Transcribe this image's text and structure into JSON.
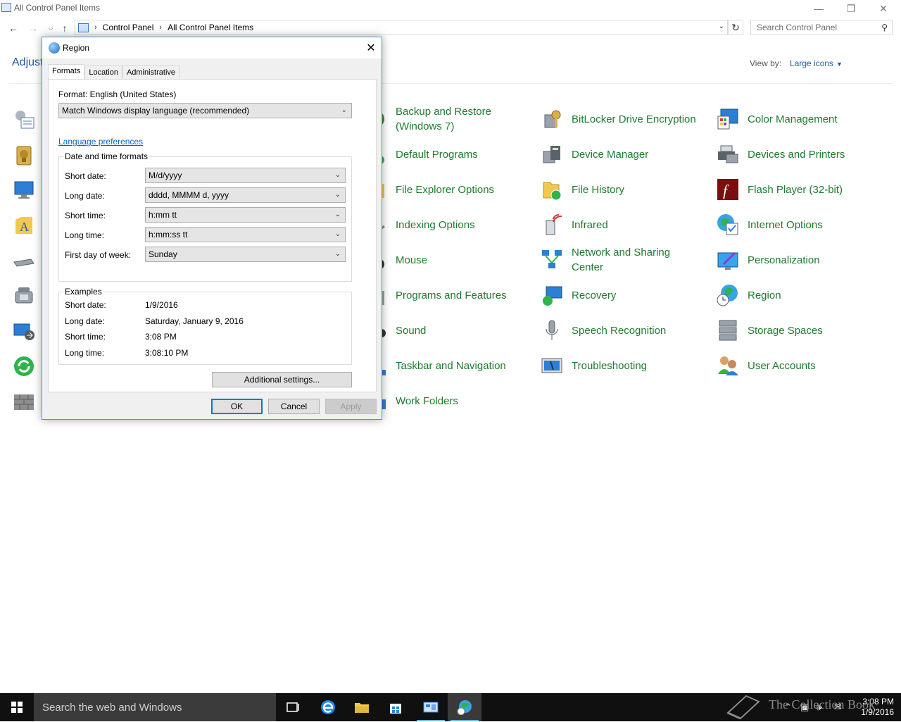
{
  "window": {
    "title": "All Control Panel Items"
  },
  "address": {
    "crumbs": [
      "Control Panel",
      "All Control Panel Items"
    ],
    "search_placeholder": "Search Control Panel"
  },
  "main": {
    "heading": "Adjust",
    "view_by_label": "View by:",
    "view_by_value": "Large icons"
  },
  "items": {
    "col1": [
      "Backup and Restore (Windows 7)",
      "Default Programs",
      "File Explorer Options",
      "Indexing Options",
      "Mouse",
      "Programs and Features",
      "Sound",
      "Taskbar and Navigation",
      "Work Folders"
    ],
    "col2": [
      "BitLocker Drive Encryption",
      "Device Manager",
      "File History",
      "Infrared",
      "Network and Sharing Center",
      "Recovery",
      "Speech Recognition",
      "Troubleshooting"
    ],
    "col3": [
      "Color Management",
      "Devices and Printers",
      "Flash Player (32-bit)",
      "Internet Options",
      "Personalization",
      "Region",
      "Storage Spaces",
      "User Accounts"
    ]
  },
  "dialog": {
    "title": "Region",
    "tabs": [
      "Formats",
      "Location",
      "Administrative"
    ],
    "format_label": "Format: English (United States)",
    "format_value": "Match Windows display language (recommended)",
    "language_link": "Language preferences",
    "dt_group_title": "Date and time formats",
    "fields": {
      "short_date": {
        "label": "Short date:",
        "value": "M/d/yyyy"
      },
      "long_date": {
        "label": "Long date:",
        "value": "dddd, MMMM d, yyyy"
      },
      "short_time": {
        "label": "Short time:",
        "value": "h:mm tt"
      },
      "long_time": {
        "label": "Long time:",
        "value": "h:mm:ss tt"
      },
      "first_day": {
        "label": "First day of week:",
        "value": "Sunday"
      }
    },
    "examples_title": "Examples",
    "examples": {
      "short_date": {
        "label": "Short date:",
        "value": "1/9/2016"
      },
      "long_date": {
        "label": "Long date:",
        "value": "Saturday, January 9, 2016"
      },
      "short_time": {
        "label": "Short time:",
        "value": "3:08 PM"
      },
      "long_time": {
        "label": "Long time:",
        "value": "3:08:10 PM"
      }
    },
    "additional_settings": "Additional settings...",
    "ok": "OK",
    "cancel": "Cancel",
    "apply": "Apply"
  },
  "taskbar": {
    "search_placeholder": "Search the web and Windows",
    "time": "3:08 PM",
    "date": "1/9/2016",
    "watermark": "The Collection Book"
  },
  "colors": {
    "link_green": "#1f7a2e",
    "accent_blue": "#0078d7",
    "taskbar": "#101010"
  }
}
